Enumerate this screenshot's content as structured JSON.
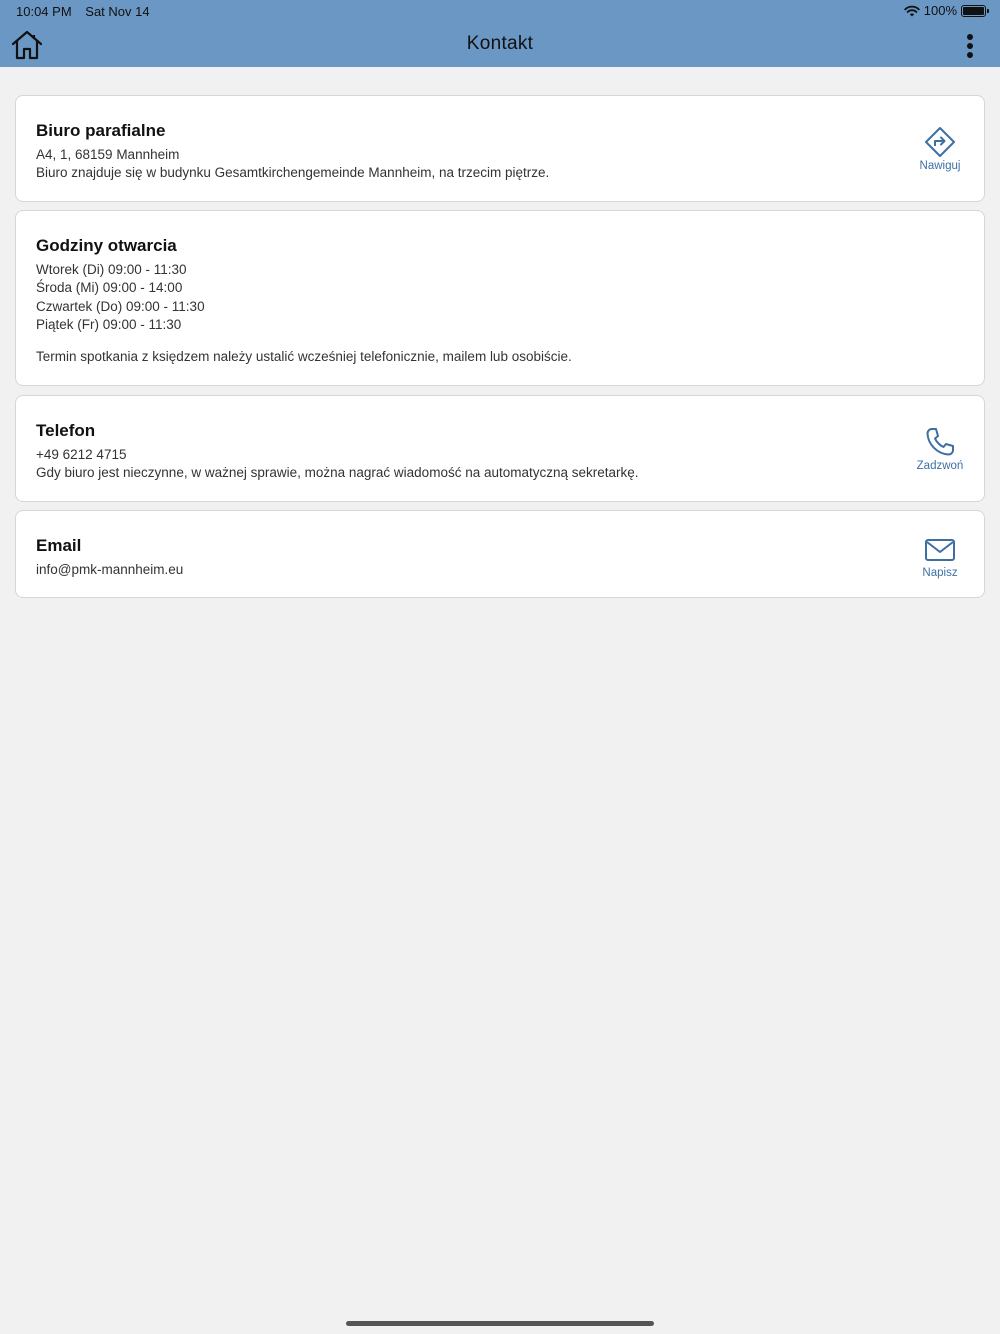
{
  "status_bar": {
    "time": "10:04 PM",
    "date": "Sat Nov 14",
    "battery": "100%"
  },
  "header": {
    "title": "Kontakt",
    "home_icon": "home-icon",
    "menu_icon": "more-vertical-icon",
    "background_color": "#6b97c4"
  },
  "office": {
    "title": "Biuro parafialne",
    "address": "A4, 1, 68159 Mannheim",
    "note": "Biuro znajduje się w budynku Gesamtkirchengemeinde Mannheim, na trzecim piętrze.",
    "action_label": "Nawiguj",
    "action_icon": "directions-icon"
  },
  "hours": {
    "title": "Godziny otwarcia",
    "lines": [
      "Wtorek (Di) 09:00 - 11:30",
      "Środa (Mi) 09:00 - 14:00",
      "Czwartek (Do) 09:00 - 11:30",
      "Piątek (Fr) 09:00 - 11:30"
    ],
    "note": "Termin spotkania z księdzem należy ustalić wcześniej telefonicznie, mailem lub osobiście."
  },
  "phone": {
    "title": "Telefon",
    "number": "+49 6212 4715",
    "note": "Gdy biuro jest nieczynne, w ważnej sprawie, można nagrać wiadomość na automatyczną sekretarkę.",
    "action_label": "Zadzwoń",
    "action_icon": "phone-icon"
  },
  "email": {
    "title": "Email",
    "address": "info@pmk-mannheim.eu",
    "action_label": "Napisz",
    "action_icon": "mail-icon"
  },
  "accent_color": "#3d6fa5"
}
